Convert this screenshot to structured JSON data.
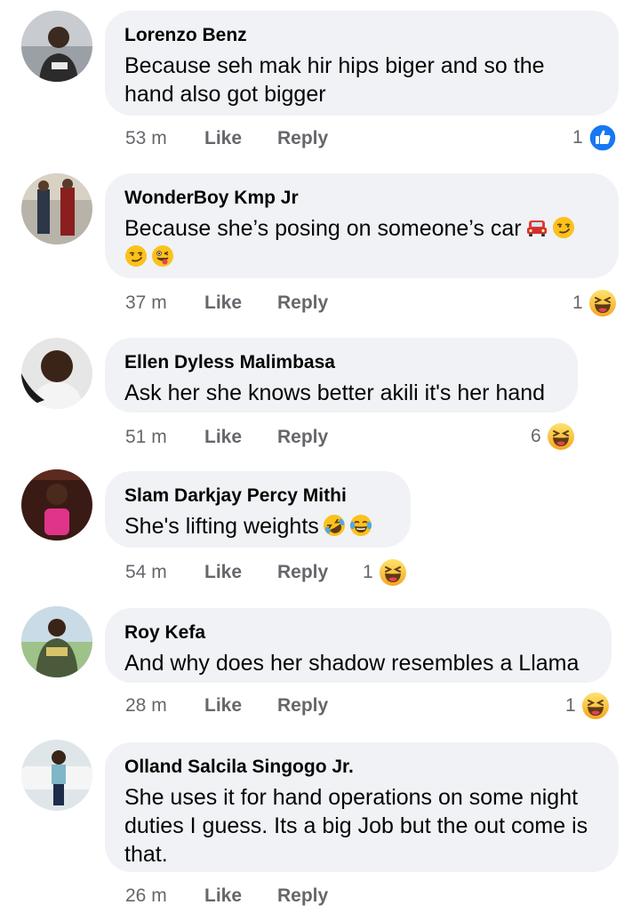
{
  "comments": [
    {
      "author": "Lorenzo Benz",
      "text": "Because seh mak hir hips biger and so the hand also got bigger",
      "time": "53 m",
      "like_label": "Like",
      "reply_label": "Reply",
      "reaction_count": "1",
      "reaction": "like-icon"
    },
    {
      "author": "WonderBoy Kmp Jr",
      "text": "Because she’s posing on someone’s car",
      "emojis": [
        "car-emoji",
        "smirk-emoji",
        "smirk-emoji",
        "winking-tongue-emoji"
      ],
      "time": "37 m",
      "like_label": "Like",
      "reply_label": "Reply",
      "reaction_count": "1",
      "reaction": "haha-icon"
    },
    {
      "author": "Ellen Dyless Malimbasa",
      "text": "Ask her she knows better akili it's her hand",
      "time": "51 m",
      "like_label": "Like",
      "reply_label": "Reply",
      "reaction_count": "6",
      "reaction": "haha-icon"
    },
    {
      "author": "Slam Darkjay Percy Mithi",
      "text": "She's lifting weights",
      "emojis": [
        "rofl-emoji",
        "tears-of-joy-emoji"
      ],
      "time": "54 m",
      "like_label": "Like",
      "reply_label": "Reply",
      "reaction_count": "1",
      "reaction": "haha-icon"
    },
    {
      "author": "Roy Kefa",
      "text": "And why does her shadow resembles a Llama",
      "time": "28 m",
      "like_label": "Like",
      "reply_label": "Reply",
      "reaction_count": "1",
      "reaction": "haha-icon"
    },
    {
      "author": "Olland Salcila Singogo Jr.",
      "text": "She uses it for hand operations on some night duties I guess.  Its a big Job but the out come is that.",
      "time": "26 m",
      "like_label": "Like",
      "reply_label": "Reply"
    }
  ],
  "colors": {
    "bubble": "#f0f2f5",
    "meta_text": "#65676b",
    "like_blue": "#1877f2",
    "haha_yellow": "#f7b928"
  }
}
